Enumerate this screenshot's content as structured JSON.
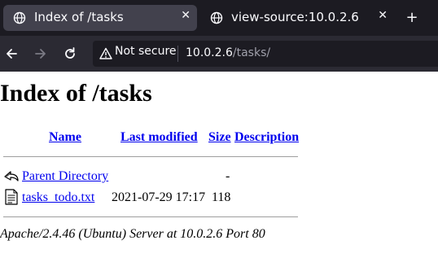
{
  "browser": {
    "tabs": [
      {
        "title": "Index of /tasks",
        "active": true
      },
      {
        "title": "view-source:10.0.2.6",
        "active": false
      }
    ],
    "new_tab_label": "+",
    "close_label": "✕",
    "security_label": "Not secure",
    "url_host": "10.0.2.6",
    "url_path": "/tasks/"
  },
  "page": {
    "heading": "Index of /tasks",
    "columns": {
      "name": "Name",
      "last_modified": "Last modified",
      "size": "Size",
      "description": "Description"
    },
    "rows": [
      {
        "icon": "back-arrow-icon",
        "name": "Parent Directory",
        "last_modified": "",
        "size": "-",
        "description": ""
      },
      {
        "icon": "text-file-icon",
        "name": "tasks_todo.txt",
        "last_modified": "2021-07-29 17:17",
        "size": "118",
        "description": ""
      }
    ],
    "server_signature": "Apache/2.4.46 (Ubuntu) Server at 10.0.2.6 Port 80"
  },
  "colors": {
    "tabstrip": "#1c1b22",
    "active_tab": "#42414d",
    "toolbar": "#2b2a33",
    "link": "#0000ee"
  }
}
